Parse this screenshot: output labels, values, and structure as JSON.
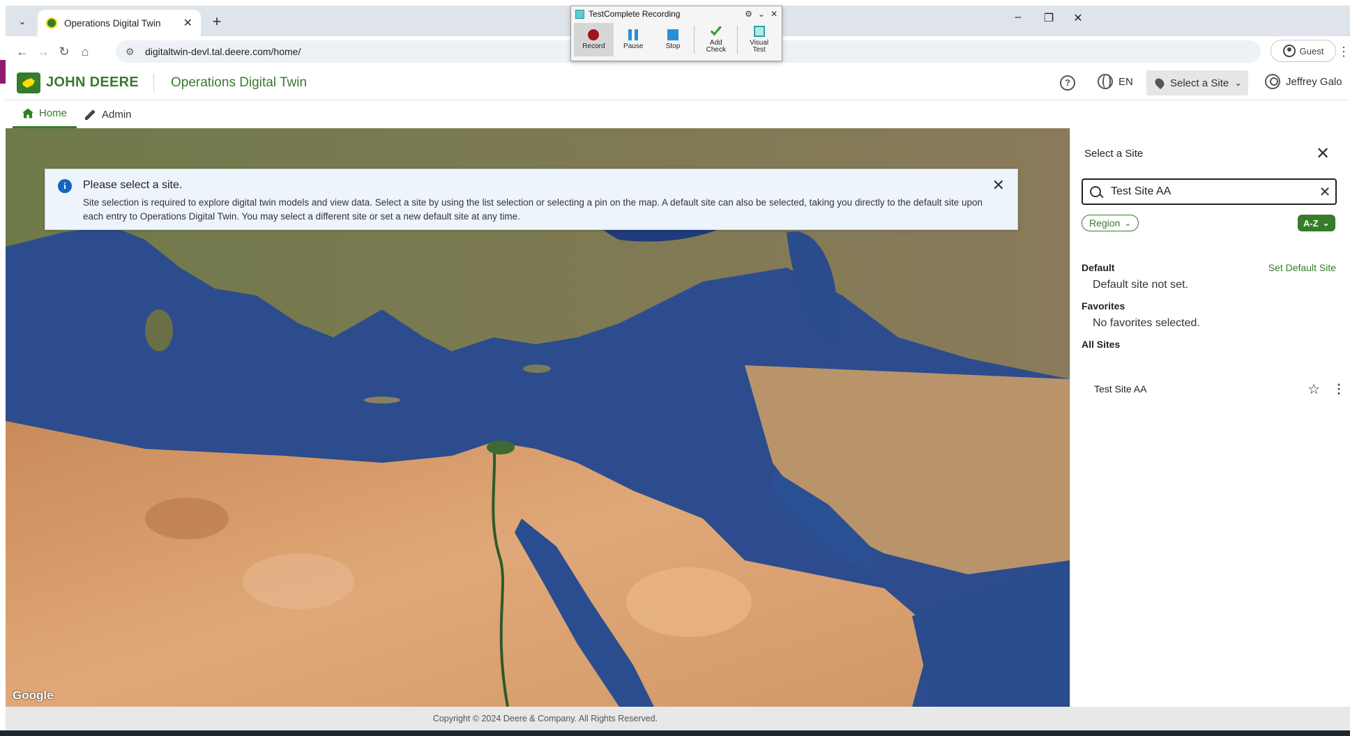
{
  "browser": {
    "tab_title": "Operations Digital Twin",
    "url": "digitaltwin-devl.tal.deere.com/home/",
    "profile_label": "Guest"
  },
  "testcomplete": {
    "title": "TestComplete Recording",
    "buttons": [
      {
        "label": "Record",
        "icon": "record-icon"
      },
      {
        "label": "Pause",
        "icon": "pause-icon"
      },
      {
        "label": "Stop",
        "icon": "stop-icon"
      },
      {
        "label": "Add Check",
        "icon": "add-check-icon"
      },
      {
        "label": "Visual Test",
        "icon": "visual-test-icon"
      }
    ]
  },
  "header": {
    "brand": "JOHN DEERE",
    "app_name": "Operations Digital Twin",
    "language": "EN",
    "site_button": "Select a Site",
    "user_name": "Jeffrey Galo"
  },
  "nav": {
    "home": "Home",
    "admin": "Admin"
  },
  "alert": {
    "title": "Please select a site.",
    "body": "Site selection is required to explore digital twin models and view data. Select a site by using the list selection or selecting a pin on the map. A default site can also be selected, taking you directly to the default site upon each entry to Operations Digital Twin. You may select a different site or set a new default site at any time."
  },
  "map": {
    "attribution": "Google"
  },
  "panel": {
    "title": "Select a Site",
    "search_value": "Test Site AA",
    "region_filter": "Region",
    "sort_label": "A-Z",
    "default_heading": "Default",
    "set_default_link": "Set Default Site",
    "default_empty": "Default site not set.",
    "favorites_heading": "Favorites",
    "favorites_empty": "No favorites selected.",
    "all_sites_heading": "All Sites",
    "sites": [
      {
        "name": "Test Site AA"
      }
    ]
  },
  "footer": {
    "copyright": "Copyright © 2024 Deere & Company. All Rights Reserved."
  },
  "colors": {
    "brand_green": "#367c2b",
    "brand_yellow": "#ffde00",
    "info_blue": "#1565c0"
  }
}
